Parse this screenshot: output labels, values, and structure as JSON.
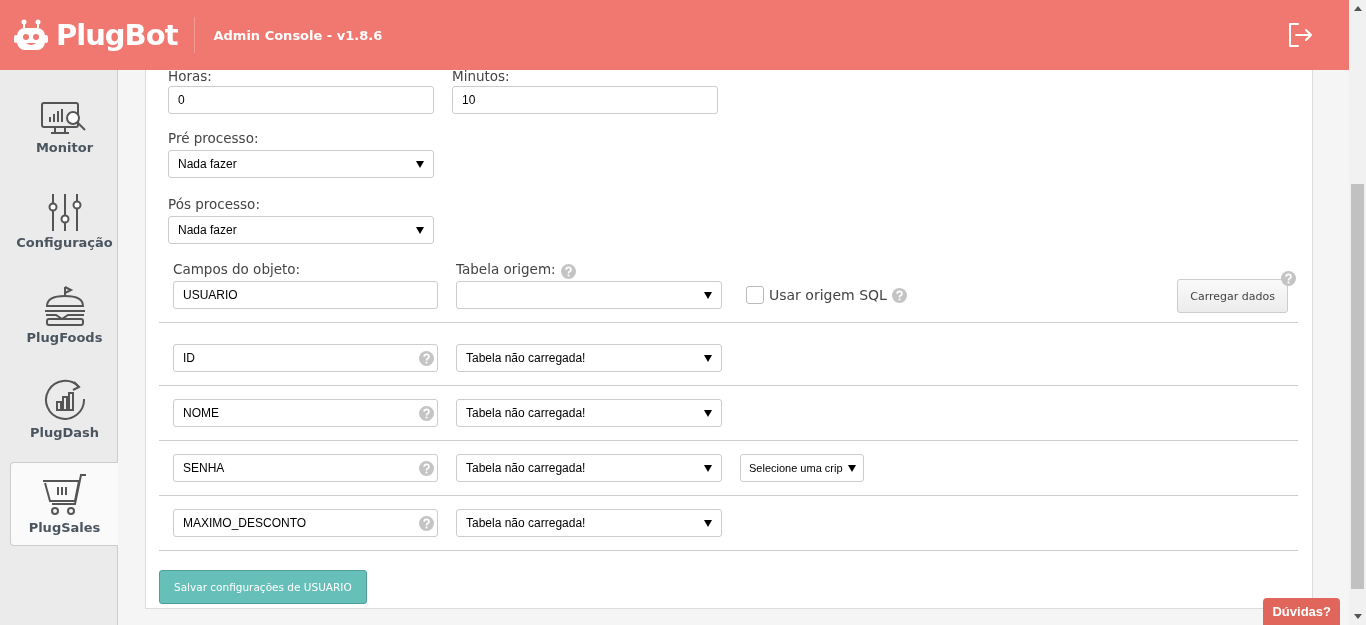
{
  "header": {
    "brand": "PlugBot",
    "subtitle": "Admin Console - v1.8.6"
  },
  "sidebar": {
    "items": [
      {
        "label": "Monitor",
        "kind": "monitor",
        "selected": false
      },
      {
        "label": "Configuração",
        "kind": "sliders",
        "selected": false
      },
      {
        "label": "PlugFoods",
        "kind": "burger",
        "selected": false
      },
      {
        "label": "PlugDash",
        "kind": "dash",
        "selected": false
      },
      {
        "label": "PlugSales",
        "kind": "cart",
        "selected": true
      }
    ]
  },
  "form": {
    "hours": {
      "label": "Horas:",
      "value": "0"
    },
    "minutes": {
      "label": "Minutos:",
      "value": "10"
    },
    "pre_process": {
      "label": "Pré processo:",
      "value": "Nada fazer"
    },
    "post_process": {
      "label": "Pós processo:",
      "value": "Nada fazer"
    },
    "object_fields": {
      "label": "Campos do objeto:",
      "value": "USUARIO"
    },
    "source_table": {
      "label": "Tabela origem:"
    },
    "sql_source": {
      "label": "Usar origem SQL",
      "checked": false
    },
    "load_button": "Carregar dados",
    "fields": [
      {
        "name": "ID",
        "mapping": "Tabela não carregada!"
      },
      {
        "name": "NOME",
        "mapping": "Tabela não carregada!"
      },
      {
        "name": "SENHA",
        "mapping": "Tabela não carregada!",
        "crypto": "Selecione uma crip"
      },
      {
        "name": "MAXIMO_DESCONTO",
        "mapping": "Tabela não carregada!"
      }
    ],
    "save_button": "Salvar configurações de USUARIO"
  },
  "help_button": "Dúvidas?"
}
